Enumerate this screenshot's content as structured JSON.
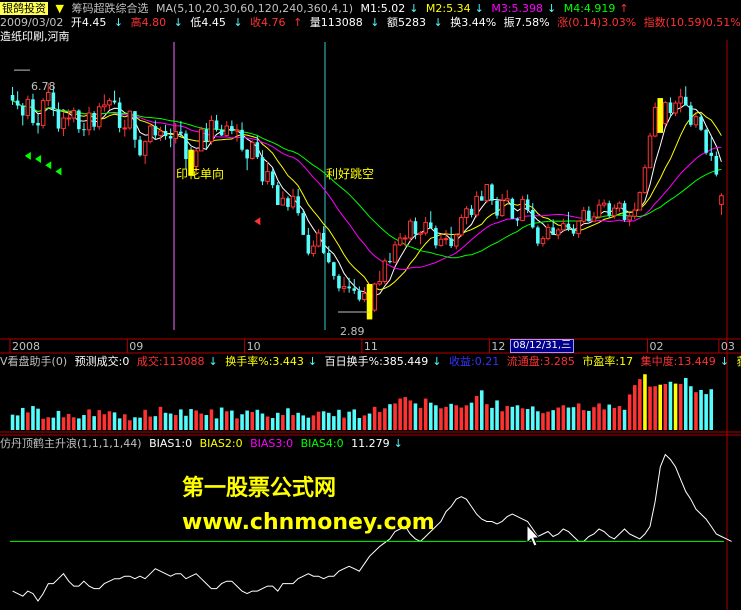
{
  "header": {
    "brand": "银鸽投资",
    "indicator": "筹码超跌综合选",
    "ma_params": "MA(5,10,20,30,60,120,240,360,4,1)",
    "m1": "M1:5.02",
    "m2": "M2:5.34",
    "m3": "M3:5.398",
    "m4": "M4:4.919",
    "date": "2009/03/02",
    "open": "开4.45",
    "high": "高4.80",
    "low": "低4.45",
    "close": "收4.76",
    "volume": "量113088",
    "amount": "额5283",
    "turnover": "换3.44%",
    "amplitude": "振7.58%",
    "change": "涨(0.14)3.03%",
    "index_change": "指数(10.59)0.51%",
    "concepts": "造纸印刷,河南"
  },
  "volume_header": {
    "title": "V看盘助手(0)",
    "forecast": "预测成交:0",
    "deal": "成交:113088",
    "turnover": "换手率%:3.443",
    "turn100": "百日换手%:385.449",
    "profit": "收益:0.21",
    "float": "流通盘:3.285",
    "pe": "市盈率:17",
    "concentration": "集中度:13.449",
    "tail": "获"
  },
  "bias_header": {
    "title": "仿丹顶鹤主升浪(1,1,1,1,44)",
    "bias1": "BIAS1:0",
    "bias2": "BIAS2:0",
    "bias3": "BIAS3:0",
    "bias4": "BIAS4:0",
    "value": "11.279"
  },
  "annotations": {
    "event1": "印花单向",
    "event2": "利好跳空",
    "high_label": "6.78",
    "low_label": "2.89",
    "cursor_date": "08/12/31,三"
  },
  "watermark": {
    "line1": "第一股票公式网",
    "line2": "www.chnmoney.com"
  },
  "colors": {
    "up": "#ff3232",
    "down": "#54fcfc",
    "ma5": "#ffffff",
    "ma10": "#ffff00",
    "ma20": "#ff00ff",
    "ma30": "#00ff00",
    "axis": "#b00000"
  },
  "chart_data": {
    "type": "candlestick",
    "x_ticks": [
      "2008",
      "09",
      "10",
      "11",
      "12",
      "02",
      "03"
    ],
    "ohlc": [
      [
        6.38,
        6.51,
        6.22,
        6.29
      ],
      [
        6.29,
        6.44,
        6.15,
        6.21
      ],
      [
        6.21,
        6.25,
        5.89,
        6.05
      ],
      [
        6.05,
        6.37,
        5.99,
        6.31
      ],
      [
        6.31,
        6.4,
        5.89,
        5.93
      ],
      [
        5.93,
        6.07,
        5.76,
        5.89
      ],
      [
        5.89,
        6.33,
        5.84,
        6.29
      ],
      [
        6.29,
        6.57,
        6.2,
        6.42
      ],
      [
        6.42,
        6.52,
        6.04,
        6.15
      ],
      [
        6.15,
        6.26,
        5.79,
        5.84
      ],
      [
        5.84,
        6.1,
        5.72,
        6.01
      ],
      [
        6.01,
        6.15,
        5.88,
        6.01
      ],
      [
        6.01,
        6.18,
        5.94,
        6.13
      ],
      [
        6.13,
        6.15,
        5.77,
        5.83
      ],
      [
        5.83,
        5.93,
        5.72,
        5.82
      ],
      [
        5.82,
        6.19,
        5.73,
        6.09
      ],
      [
        6.09,
        6.12,
        5.81,
        5.87
      ],
      [
        5.87,
        6.25,
        5.82,
        6.19
      ],
      [
        6.19,
        6.39,
        6.11,
        6.22
      ],
      [
        6.22,
        6.33,
        6.14,
        6.29
      ],
      [
        6.29,
        6.45,
        6.23,
        6.26
      ],
      [
        6.26,
        6.34,
        5.78,
        5.85
      ],
      [
        5.85,
        5.98,
        5.71,
        5.85
      ],
      [
        5.85,
        6.13,
        5.82,
        6.12
      ],
      [
        6.12,
        6.12,
        5.53,
        5.66
      ],
      [
        5.66,
        5.72,
        5.39,
        5.41
      ],
      [
        5.41,
        5.65,
        5.27,
        5.63
      ],
      [
        5.63,
        5.93,
        5.6,
        5.88
      ],
      [
        5.88,
        5.97,
        5.66,
        5.73
      ],
      [
        5.73,
        5.87,
        5.64,
        5.8
      ],
      [
        5.8,
        5.9,
        5.66,
        5.72
      ],
      [
        5.72,
        5.84,
        5.54,
        5.68
      ],
      [
        5.68,
        5.93,
        5.6,
        5.79
      ],
      [
        5.79,
        5.96,
        5.71,
        5.76
      ],
      [
        5.76,
        5.81,
        5.19,
        5.35
      ],
      [
        5.35,
        5.54,
        5.18,
        5.23
      ],
      [
        5.23,
        5.51,
        5.12,
        5.48
      ],
      [
        5.48,
        5.87,
        5.48,
        5.83
      ],
      [
        5.83,
        5.93,
        5.52,
        5.63
      ],
      [
        5.63,
        6.05,
        5.58,
        5.97
      ],
      [
        5.97,
        6.06,
        5.79,
        5.82
      ],
      [
        5.82,
        5.9,
        5.72,
        5.73
      ],
      [
        5.73,
        5.96,
        5.71,
        5.88
      ],
      [
        5.88,
        5.97,
        5.75,
        5.8
      ],
      [
        5.8,
        5.91,
        5.63,
        5.82
      ],
      [
        5.82,
        5.94,
        5.47,
        5.5
      ],
      [
        5.5,
        5.51,
        5.17,
        5.36
      ],
      [
        5.36,
        5.65,
        5.34,
        5.62
      ],
      [
        5.62,
        5.72,
        5.35,
        5.38
      ],
      [
        5.38,
        5.49,
        4.93,
        4.99
      ],
      [
        4.99,
        5.31,
        4.94,
        5.15
      ],
      [
        5.15,
        5.2,
        4.88,
        4.93
      ],
      [
        4.93,
        4.98,
        4.61,
        4.61
      ],
      [
        4.61,
        4.83,
        4.6,
        4.72
      ],
      [
        4.72,
        4.75,
        4.52,
        4.58
      ],
      [
        4.58,
        4.87,
        4.54,
        4.75
      ],
      [
        4.75,
        4.87,
        4.44,
        4.48
      ],
      [
        4.48,
        4.53,
        4.13,
        4.13
      ],
      [
        4.13,
        4.24,
        3.8,
        3.83
      ],
      [
        3.83,
        4.04,
        3.78,
        3.95
      ],
      [
        3.95,
        4.22,
        3.93,
        4.16
      ],
      [
        4.16,
        4.27,
        3.82,
        3.84
      ],
      [
        3.84,
        3.95,
        3.67,
        3.69
      ],
      [
        3.69,
        3.7,
        3.41,
        3.47
      ],
      [
        3.47,
        3.5,
        3.22,
        3.27
      ],
      [
        3.27,
        3.45,
        3.2,
        3.3
      ],
      [
        3.3,
        3.44,
        3.2,
        3.27
      ],
      [
        3.27,
        3.42,
        3.18,
        3.23
      ],
      [
        3.23,
        3.3,
        3.06,
        3.09
      ],
      [
        3.09,
        3.29,
        3.05,
        3.19
      ],
      [
        3.19,
        3.2,
        2.89,
        2.92
      ],
      [
        2.92,
        3.36,
        2.89,
        3.34
      ],
      [
        3.34,
        3.55,
        3.31,
        3.38
      ],
      [
        3.38,
        3.75,
        3.34,
        3.71
      ],
      [
        3.71,
        3.84,
        3.67,
        3.69
      ],
      [
        3.69,
        4.03,
        3.68,
        3.97
      ],
      [
        3.97,
        4.16,
        3.95,
        4.08
      ],
      [
        4.08,
        4.13,
        3.94,
        4.08
      ],
      [
        4.08,
        4.39,
        4.03,
        4.35
      ],
      [
        4.35,
        4.41,
        4.06,
        4.14
      ],
      [
        4.14,
        4.19,
        3.98,
        4.16
      ],
      [
        4.16,
        4.42,
        4.12,
        4.33
      ],
      [
        4.33,
        4.51,
        4.24,
        4.24
      ],
      [
        4.24,
        4.28,
        3.91,
        3.96
      ],
      [
        3.96,
        4.15,
        3.94,
        4.06
      ],
      [
        4.06,
        4.21,
        3.97,
        4.07
      ],
      [
        4.07,
        4.26,
        3.92,
        3.95
      ],
      [
        3.95,
        4.15,
        3.9,
        4.13
      ],
      [
        4.13,
        4.46,
        4.1,
        4.41
      ],
      [
        4.41,
        4.59,
        4.3,
        4.55
      ],
      [
        4.55,
        4.61,
        4.41,
        4.45
      ],
      [
        4.45,
        4.83,
        4.41,
        4.75
      ],
      [
        4.75,
        4.84,
        4.68,
        4.68
      ],
      [
        4.68,
        4.95,
        4.65,
        4.94
      ],
      [
        4.94,
        4.96,
        4.61,
        4.68
      ],
      [
        4.68,
        4.74,
        4.39,
        4.44
      ],
      [
        4.44,
        4.79,
        4.42,
        4.68
      ],
      [
        4.68,
        4.85,
        4.67,
        4.71
      ],
      [
        4.71,
        4.73,
        4.39,
        4.39
      ],
      [
        4.39,
        4.41,
        4.27,
        4.36
      ],
      [
        4.36,
        4.76,
        4.35,
        4.7
      ],
      [
        4.7,
        4.78,
        4.48,
        4.53
      ],
      [
        4.53,
        4.64,
        4.23,
        4.25
      ],
      [
        4.25,
        4.28,
        3.95,
        3.99
      ],
      [
        3.99,
        4.11,
        3.94,
        4.07
      ],
      [
        4.07,
        4.31,
        4.04,
        4.25
      ],
      [
        4.25,
        4.38,
        4.13,
        4.13
      ],
      [
        4.13,
        4.24,
        4.06,
        4.21
      ],
      [
        4.21,
        4.39,
        4.19,
        4.31
      ],
      [
        4.31,
        4.5,
        4.19,
        4.23
      ],
      [
        4.23,
        4.3,
        4.11,
        4.15
      ],
      [
        4.15,
        4.36,
        4.08,
        4.35
      ],
      [
        4.35,
        4.58,
        4.29,
        4.52
      ],
      [
        4.52,
        4.59,
        4.34,
        4.35
      ],
      [
        4.35,
        4.5,
        4.33,
        4.42
      ],
      [
        4.42,
        4.7,
        4.39,
        4.61
      ],
      [
        4.61,
        4.7,
        4.57,
        4.64
      ],
      [
        4.64,
        4.68,
        4.41,
        4.44
      ],
      [
        4.44,
        4.62,
        4.39,
        4.56
      ],
      [
        4.56,
        4.67,
        4.5,
        4.64
      ],
      [
        4.64,
        4.68,
        4.34,
        4.37
      ],
      [
        4.37,
        4.49,
        4.27,
        4.43
      ],
      [
        4.43,
        4.65,
        4.38,
        4.53
      ],
      [
        4.53,
        4.83,
        4.53,
        4.81
      ],
      [
        4.81,
        5.26,
        4.79,
        5.21
      ],
      [
        5.21,
        5.77,
        5.2,
        5.72
      ],
      [
        5.72,
        6.26,
        5.7,
        6.18
      ],
      [
        6.18,
        6.33,
        5.86,
        5.92
      ],
      [
        5.92,
        6.28,
        5.88,
        6.26
      ],
      [
        6.26,
        6.34,
        6.02,
        6.09
      ],
      [
        6.09,
        6.29,
        6.04,
        6.25
      ],
      [
        6.25,
        6.48,
        6.1,
        6.35
      ],
      [
        6.35,
        6.52,
        6.21,
        6.21
      ],
      [
        6.21,
        6.27,
        5.87,
        5.9
      ],
      [
        5.9,
        6.08,
        5.85,
        6.03
      ],
      [
        6.03,
        6.08,
        5.8,
        5.82
      ],
      [
        5.82,
        5.84,
        5.42,
        5.45
      ],
      [
        5.45,
        5.7,
        5.32,
        5.4
      ],
      [
        5.4,
        5.47,
        5.07,
        5.1
      ],
      [
        4.62,
        4.8,
        4.45,
        4.76
      ]
    ],
    "volume": [
      41,
      39,
      59,
      47,
      64,
      57,
      30,
      34,
      33,
      51,
      34,
      43,
      34,
      31,
      40,
      55,
      37,
      53,
      42,
      50,
      47,
      31,
      42,
      26,
      34,
      33,
      54,
      36,
      37,
      62,
      46,
      44,
      40,
      55,
      38,
      56,
      52,
      44,
      40,
      55,
      31,
      60,
      50,
      52,
      31,
      42,
      52,
      48,
      54,
      44,
      36,
      32,
      46,
      40,
      58,
      40,
      46,
      39,
      33,
      39,
      49,
      50,
      46,
      37,
      54,
      33,
      49,
      55,
      32,
      39,
      44,
      62,
      48,
      58,
      69,
      71,
      84,
      88,
      79,
      71,
      59,
      84,
      73,
      66,
      58,
      62,
      70,
      66,
      60,
      66,
      73,
      91,
      106,
      69,
      59,
      79,
      50,
      64,
      62,
      66,
      58,
      56,
      63,
      50,
      45,
      49,
      53,
      60,
      66,
      60,
      61,
      71,
      53,
      51,
      61,
      71,
      55,
      68,
      59,
      64,
      54,
      95,
      120,
      136,
      149,
      116,
      117,
      121,
      123,
      129,
      124,
      123,
      139,
      117,
      101,
      107,
      96,
      109
    ],
    "bias": [
      -20,
      -21,
      -22,
      -20,
      -21,
      -24,
      -21,
      -17,
      -17,
      -15,
      -13,
      -16,
      -18,
      -18,
      -16,
      -18,
      -19,
      -19,
      -17,
      -16,
      -15,
      -15,
      -14,
      -14,
      -15,
      -14,
      -15,
      -13,
      -11,
      -12,
      -13,
      -14,
      -13,
      -13,
      -15,
      -14,
      -13,
      -15,
      -17,
      -19,
      -19,
      -17,
      -16,
      -16,
      -18,
      -20,
      -21,
      -20,
      -20,
      -19,
      -18,
      -18,
      -20,
      -17,
      -17,
      -17,
      -15,
      -14,
      -13,
      -14,
      -14,
      -15,
      -14,
      -14,
      -12,
      -11,
      -10,
      -11,
      -12,
      -9,
      -6,
      -4,
      -2,
      -0.5,
      1,
      4,
      5,
      6,
      3,
      1,
      0,
      2,
      4,
      6,
      8,
      12,
      14,
      17,
      18,
      17,
      14,
      11,
      9,
      8,
      8,
      7,
      8,
      10,
      11,
      10,
      9,
      8,
      5,
      2,
      3,
      4,
      2,
      3,
      5,
      4,
      2,
      0,
      0,
      2,
      3,
      5,
      4,
      2,
      1,
      3,
      5,
      3,
      2,
      1,
      3,
      6,
      16,
      30,
      35,
      33,
      30,
      25,
      20,
      17,
      13,
      11,
      9,
      6,
      3,
      2,
      1,
      0
    ],
    "bias_zero": 0,
    "ylim": [
      2.6,
      7.2
    ],
    "vlim": [
      0,
      155
    ],
    "blim": [
      -26,
      36
    ]
  }
}
